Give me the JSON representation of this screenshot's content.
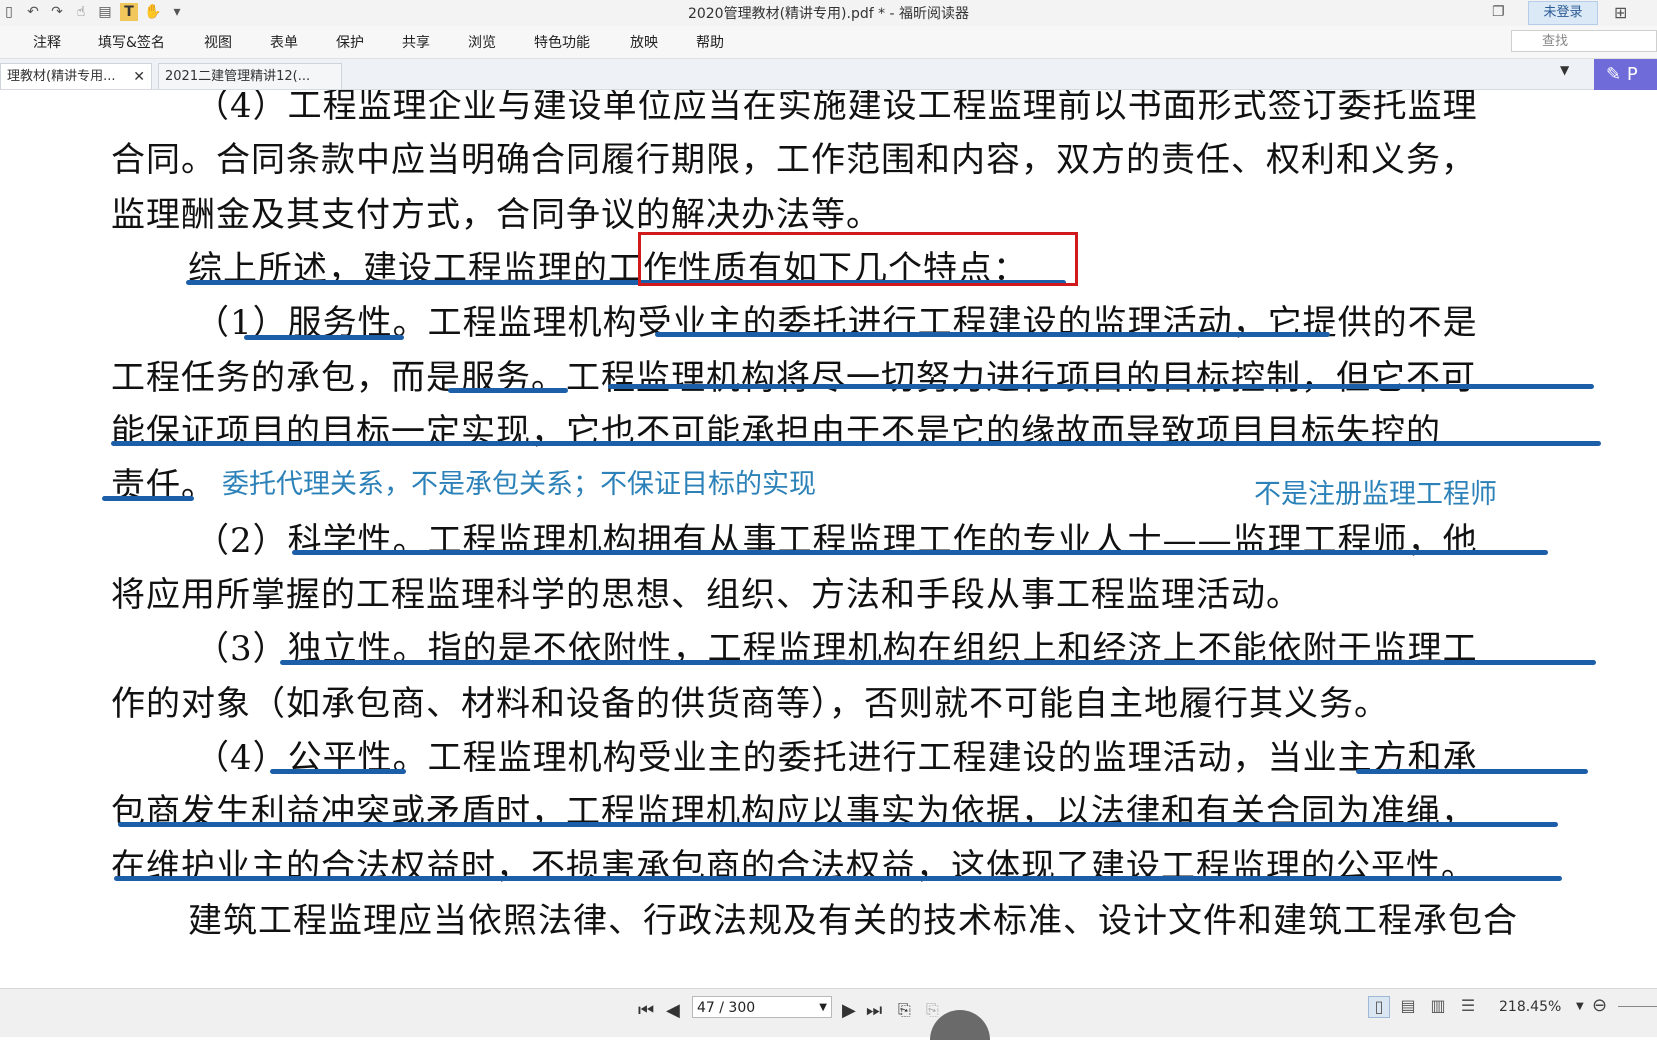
{
  "window": {
    "title": "2020管理教材(精讲专用).pdf * - 福昕阅读器",
    "login": "未登录"
  },
  "menu": [
    "注释",
    "填写&签名",
    "视图",
    "表单",
    "保护",
    "共享",
    "浏览",
    "特色功能",
    "放映",
    "帮助"
  ],
  "search": {
    "placeholder": "查找"
  },
  "tabs": [
    {
      "label": "理教材(精讲专用...",
      "active": true
    },
    {
      "label": "2021二建管理精讲12(...",
      "active": false
    }
  ],
  "pen_label": "P",
  "doc": {
    "lines": [
      "（4）工程监理企业与建设单位应当在实施建设工程监理前以书面形式签订委托监理",
      "合同。合同条款中应当明确合同履行期限，工作范围和内容，双方的责任、权利和义务，",
      "监理酬金及其支付方式，合同争议的解决办法等。",
      "综上所述，建设工程监理的工作性质有如下几个特点：",
      "（1）服务性。工程监理机构受业主的委托进行工程建设的监理活动，它提供的不是",
      "工程任务的承包，而是服务。工程监理机构将尽一切努力进行项目的目标控制，但它不可",
      "能保证项目的目标一定实现，它也不可能承担由于不是它的缘故而导致项目目标失控的",
      "责任。",
      "（2）科学性。工程监理机构拥有从事工程监理工作的专业人士——监理工程师，他",
      "将应用所掌握的工程监理科学的思想、组织、方法和手段从事工程监理活动。",
      "（3）独立性。指的是不依附性，工程监理机构在组织上和经济上不能依附于监理工",
      "作的对象（如承包商、材料和设备的供货商等），否则就不可能自主地履行其义务。",
      "（4）公平性。工程监理机构受业主的委托进行工程建设的监理活动，当业主方和承",
      "包商发生利益冲突或矛盾时，工程监理机构应以事实为依据，以法律和有关合同为准绳，",
      "在维护业主的合法权益时，不损害承包商的合法权益，这体现了建设工程监理的公平性。",
      "建筑工程监理应当依照法律、行政法规及有关的技术标准、设计文件和建筑工程承包合"
    ],
    "notes": [
      "委托代理关系，不是承包关系；不保证目标的实现",
      "不是注册监理工程师"
    ]
  },
  "status": {
    "page": "47 / 300",
    "zoom": "218.45%"
  },
  "colors": {
    "underline": "#1d5ea8",
    "highlight_box": "#d0191b",
    "note": "#2c82b8",
    "pen": "#6f6bd8"
  }
}
